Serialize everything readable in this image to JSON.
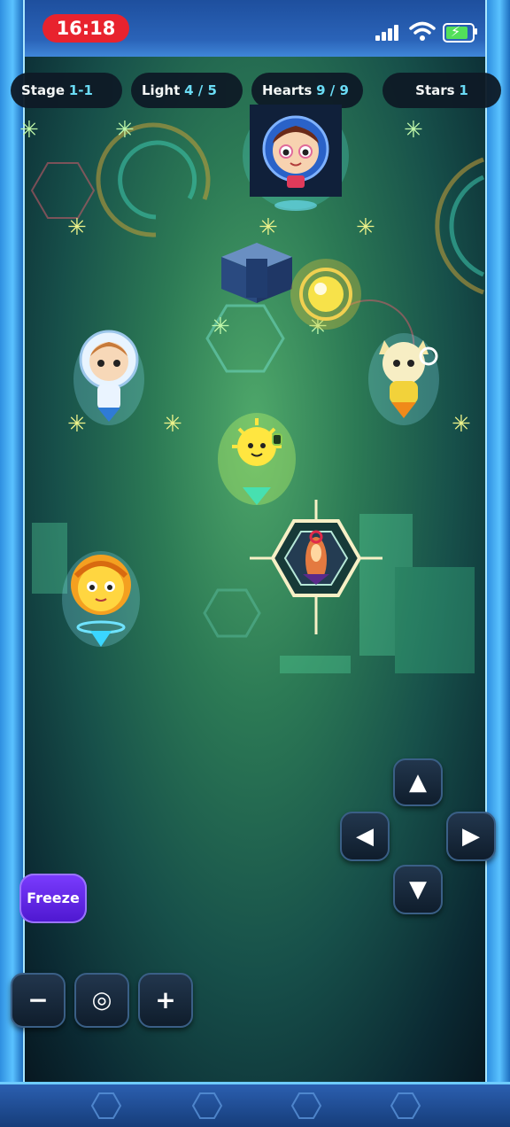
{
  "status_bar": {
    "time": "16:18"
  },
  "hud": {
    "stage": {
      "label": "Stage",
      "value": "1-1"
    },
    "light": {
      "label": "Light",
      "value": "4 / 5"
    },
    "hearts": {
      "label": "Hearts",
      "value": "9 / 9"
    },
    "stars": {
      "label": "Stars",
      "value": "1"
    }
  },
  "controls": {
    "freeze_label": "Freeze",
    "zoom_out_label": "−",
    "recenter_label": "◎",
    "zoom_in_label": "+",
    "up_label": "▲",
    "down_label": "▼",
    "left_label": "◀",
    "right_label": "▶"
  },
  "colors": {
    "accent": "#6fe3ff",
    "freeze": "#5b22e0",
    "time_pill": "#e8232e"
  }
}
